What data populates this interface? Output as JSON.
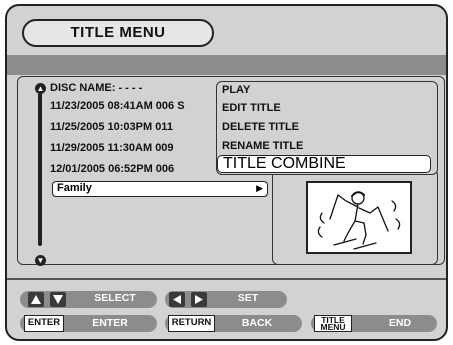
{
  "header": {
    "title": "TITLE MENU"
  },
  "disc": {
    "label": "DISC NAME: - - - -"
  },
  "titles": [
    "11/23/2005 08:41AM 006 S",
    "11/25/2005 10:03PM 011",
    "11/29/2005 11:30AM 009",
    "12/01/2005 06:52PM 006"
  ],
  "selected_title": "Family",
  "selected_arrow": "▶",
  "menu": [
    "PLAY",
    "EDIT TITLE",
    "DELETE TITLE",
    "RENAME TITLE",
    "TITLE COMBINE"
  ],
  "scroll": {
    "up": "▲",
    "down": "▼"
  },
  "bottom": {
    "select_label": "SELECT",
    "set_label": "SET",
    "enter_btn": "ENTER",
    "enter_label": "ENTER",
    "return_btn": "RETURN",
    "back_label": "BACK",
    "title_menu_btn_line1": "TITLE",
    "title_menu_btn_line2": "MENU",
    "end_label": "END"
  }
}
